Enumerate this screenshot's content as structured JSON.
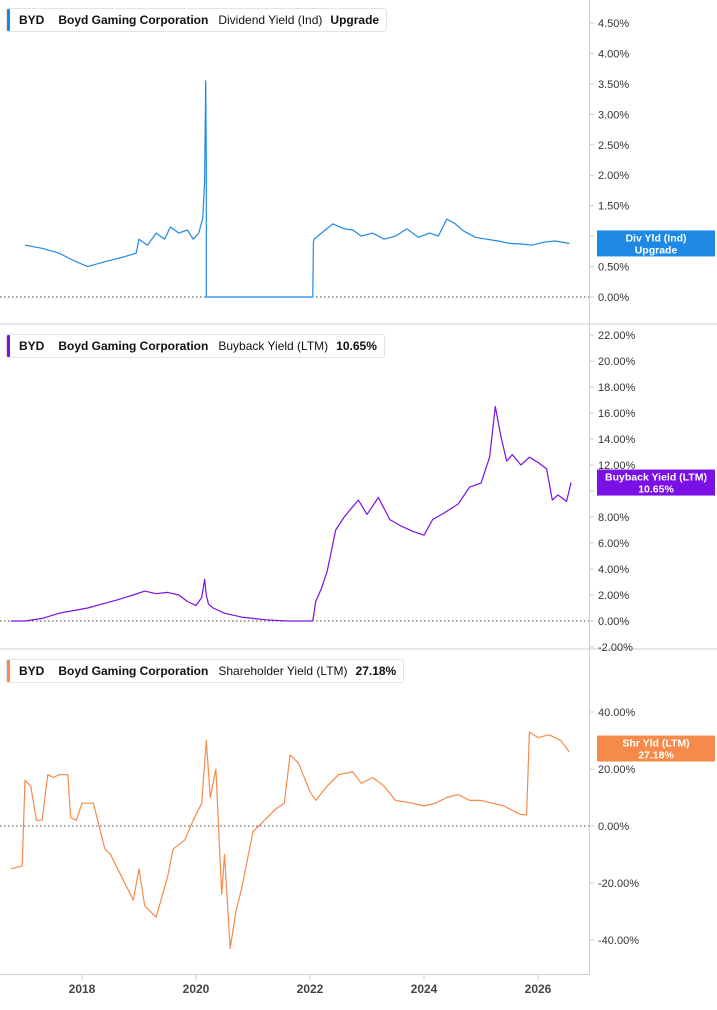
{
  "colors": {
    "panel1": "#1e88e5",
    "panel2": "#7b10e6",
    "panel3": "#f58a4b",
    "axis": "#cfcfcf",
    "text": "#333333"
  },
  "panels": [
    {
      "ticker": "BYD",
      "company": "Boyd Gaming Corporation",
      "metric": "Dividend Yield (Ind)",
      "value": "Upgrade",
      "badge": [
        "Div Yld (Ind)",
        "Upgrade"
      ],
      "badge_value": 0.88,
      "ticks": [
        "4.50%",
        "4.00%",
        "3.50%",
        "3.00%",
        "2.50%",
        "2.00%",
        "1.50%",
        "1.00%",
        "0.50%",
        "0.00%"
      ]
    },
    {
      "ticker": "BYD",
      "company": "Boyd Gaming Corporation",
      "metric": "Buyback Yield (LTM)",
      "value": "10.65%",
      "badge": [
        "Buyback Yield (LTM)",
        "10.65%"
      ],
      "badge_value": 10.65,
      "ticks": [
        "22.00%",
        "20.00%",
        "18.00%",
        "16.00%",
        "14.00%",
        "12.00%",
        "10.00%",
        "8.00%",
        "6.00%",
        "4.00%",
        "2.00%",
        "0.00%",
        "-2.00%"
      ]
    },
    {
      "ticker": "BYD",
      "company": "Boyd Gaming Corporation",
      "metric": "Shareholder Yield (LTM)",
      "value": "27.18%",
      "badge": [
        "Shr Yld (LTM)",
        "27.18%"
      ],
      "badge_value": 27.18,
      "ticks": [
        "40.00%",
        "20.00%",
        "0.00%",
        "-20.00%",
        "-40.00%"
      ]
    }
  ],
  "x_ticks": [
    "2018",
    "2020",
    "2022",
    "2024",
    "2026"
  ],
  "chart_data": [
    {
      "type": "line",
      "ylim": [
        0,
        4.75
      ],
      "y_ticks": [
        4.5,
        4.0,
        3.5,
        3.0,
        2.5,
        2.0,
        1.5,
        1.0,
        0.5,
        0.0
      ],
      "x_ticks": [
        2018,
        2020,
        2022,
        2024,
        2026
      ],
      "xlim": [
        2016.75,
        2027
      ],
      "grid": false,
      "series": [
        {
          "name": "Dividend Yield (Ind)",
          "x": [
            2017.0,
            2017.3,
            2017.6,
            2017.85,
            2018.1,
            2018.4,
            2018.7,
            2018.95,
            2019.0,
            2019.15,
            2019.3,
            2019.45,
            2019.55,
            2019.7,
            2019.85,
            2019.95,
            2020.05,
            2020.12,
            2020.15,
            2020.17,
            2020.18,
            2020.18,
            2020.19,
            2022.05,
            2022.06,
            2022.07,
            2022.2,
            2022.4,
            2022.6,
            2022.75,
            2022.9,
            2023.1,
            2023.3,
            2023.5,
            2023.7,
            2023.9,
            2024.1,
            2024.25,
            2024.4,
            2024.55,
            2024.7,
            2024.9,
            2025.1,
            2025.3,
            2025.5,
            2025.7,
            2025.9,
            2026.1,
            2026.3,
            2026.55
          ],
          "y": [
            0.85,
            0.8,
            0.72,
            0.6,
            0.5,
            0.58,
            0.65,
            0.72,
            0.95,
            0.85,
            1.05,
            0.95,
            1.15,
            1.05,
            1.1,
            0.95,
            1.05,
            1.3,
            1.9,
            3.55,
            2.2,
            0.0,
            0.0,
            0.0,
            0.9,
            0.95,
            1.05,
            1.2,
            1.12,
            1.1,
            1.0,
            1.05,
            0.95,
            1.0,
            1.12,
            0.98,
            1.05,
            1.0,
            1.28,
            1.2,
            1.08,
            0.98,
            0.95,
            0.92,
            0.88,
            0.87,
            0.85,
            0.9,
            0.92,
            0.88
          ]
        }
      ]
    },
    {
      "type": "line",
      "ylim": [
        -2.5,
        23
      ],
      "y_ticks": [
        22,
        20,
        18,
        16,
        14,
        12,
        10,
        8,
        6,
        4,
        2,
        0,
        -2
      ],
      "x_ticks": [
        2018,
        2020,
        2022,
        2024,
        2026
      ],
      "xlim": [
        2016.75,
        2027
      ],
      "grid": false,
      "series": [
        {
          "name": "Buyback Yield (LTM)",
          "x": [
            2016.75,
            2017.0,
            2017.3,
            2017.6,
            2017.85,
            2018.1,
            2018.35,
            2018.6,
            2018.9,
            2019.1,
            2019.3,
            2019.5,
            2019.7,
            2019.85,
            2020.0,
            2020.1,
            2020.15,
            2020.18,
            2020.22,
            2020.3,
            2020.5,
            2020.8,
            2021.2,
            2021.6,
            2022.05,
            2022.1,
            2022.2,
            2022.3,
            2022.45,
            2022.6,
            2022.75,
            2022.85,
            2023.0,
            2023.2,
            2023.4,
            2023.6,
            2023.8,
            2024.0,
            2024.15,
            2024.35,
            2024.6,
            2024.8,
            2025.0,
            2025.15,
            2025.25,
            2025.35,
            2025.45,
            2025.55,
            2025.7,
            2025.85,
            2026.0,
            2026.15,
            2026.25,
            2026.35,
            2026.5,
            2026.58
          ],
          "y": [
            0.0,
            0.0,
            0.2,
            0.6,
            0.8,
            1.0,
            1.3,
            1.6,
            2.0,
            2.3,
            2.1,
            2.2,
            2.0,
            1.5,
            1.2,
            1.8,
            3.2,
            2.0,
            1.3,
            1.0,
            0.6,
            0.3,
            0.1,
            0.0,
            0.0,
            1.5,
            2.5,
            3.8,
            7.0,
            8.0,
            8.8,
            9.3,
            8.2,
            9.5,
            7.8,
            7.3,
            6.9,
            6.6,
            7.8,
            8.3,
            9.0,
            10.3,
            10.6,
            12.6,
            16.5,
            14.2,
            12.3,
            12.8,
            12.0,
            12.6,
            12.2,
            11.7,
            9.3,
            9.7,
            9.2,
            10.65
          ]
        }
      ]
    },
    {
      "type": "line",
      "ylim": [
        -52,
        55
      ],
      "y_ticks": [
        40,
        20,
        0,
        -20,
        -40
      ],
      "x_ticks": [
        2018,
        2020,
        2022,
        2024,
        2026
      ],
      "xlim": [
        2016.75,
        2027
      ],
      "grid": false,
      "series": [
        {
          "name": "Shareholder Yield (LTM)",
          "x": [
            2016.75,
            2016.95,
            2017.0,
            2017.1,
            2017.2,
            2017.3,
            2017.4,
            2017.5,
            2017.6,
            2017.75,
            2017.8,
            2017.9,
            2018.0,
            2018.1,
            2018.2,
            2018.4,
            2018.5,
            2018.7,
            2018.9,
            2019.0,
            2019.1,
            2019.3,
            2019.5,
            2019.6,
            2019.8,
            2019.95,
            2020.1,
            2020.18,
            2020.25,
            2020.35,
            2020.45,
            2020.5,
            2020.6,
            2020.7,
            2020.8,
            2021.0,
            2021.2,
            2021.4,
            2021.55,
            2021.65,
            2021.8,
            2022.0,
            2022.1,
            2022.3,
            2022.5,
            2022.75,
            2022.9,
            2023.1,
            2023.3,
            2023.5,
            2023.8,
            2024.0,
            2024.2,
            2024.4,
            2024.6,
            2024.8,
            2025.0,
            2025.2,
            2025.4,
            2025.6,
            2025.7,
            2025.8,
            2025.85,
            2026.0,
            2026.2,
            2026.4,
            2026.55
          ],
          "y": [
            -15,
            -14,
            16,
            14,
            2,
            2,
            18,
            17,
            18,
            18,
            3,
            2,
            8,
            8,
            8,
            -8,
            -10,
            -18,
            -26,
            -15,
            -28,
            -32,
            -18,
            -8,
            -5,
            2,
            8,
            30,
            10,
            20,
            -24,
            -10,
            -43,
            -30,
            -22,
            -2,
            2,
            6,
            8,
            25,
            22,
            12,
            9,
            14,
            18,
            19,
            15,
            17,
            14,
            9,
            8,
            7,
            8,
            10,
            11,
            9,
            9,
            8,
            7,
            5,
            4,
            4,
            33,
            31,
            32,
            30,
            26
          ]
        }
      ]
    }
  ]
}
